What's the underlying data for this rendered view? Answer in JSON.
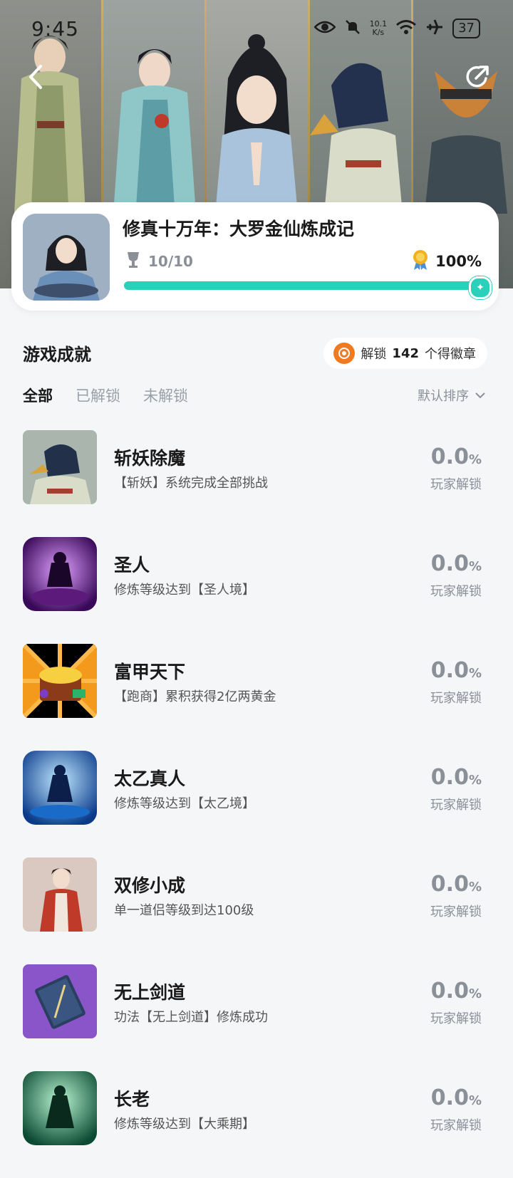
{
  "status_bar": {
    "time": "9:45",
    "net_speed_value": "10.1",
    "net_speed_unit": "K/s",
    "battery": "37"
  },
  "game": {
    "title": "修真十万年：大罗金仙炼成记",
    "trophy_count": "10/10",
    "completion": "100%",
    "progress": 1.0
  },
  "section": {
    "title": "游戏成就",
    "badge_prefix": "解锁",
    "badge_count": "142",
    "badge_suffix": "个得徽章"
  },
  "tabs": [
    "全部",
    "已解锁",
    "未解锁"
  ],
  "sort_label": "默认排序",
  "achievements": [
    {
      "title": "斩妖除魔",
      "desc": "【斩妖】系统完成全部挑战",
      "pct": "0.0",
      "unit": "%",
      "label": "玩家解锁"
    },
    {
      "title": "圣人",
      "desc": "修炼等级达到【圣人境】",
      "pct": "0.0",
      "unit": "%",
      "label": "玩家解锁"
    },
    {
      "title": "富甲天下",
      "desc": "【跑商】累积获得2亿两黄金",
      "pct": "0.0",
      "unit": "%",
      "label": "玩家解锁"
    },
    {
      "title": "太乙真人",
      "desc": "修炼等级达到【太乙境】",
      "pct": "0.0",
      "unit": "%",
      "label": "玩家解锁"
    },
    {
      "title": "双修小成",
      "desc": "单一道侣等级到达100级",
      "pct": "0.0",
      "unit": "%",
      "label": "玩家解锁"
    },
    {
      "title": "无上剑道",
      "desc": "功法【无上剑道】修炼成功",
      "pct": "0.0",
      "unit": "%",
      "label": "玩家解锁"
    },
    {
      "title": "长老",
      "desc": "修炼等级达到【大乘期】",
      "pct": "0.0",
      "unit": "%",
      "label": "玩家解锁"
    }
  ],
  "colors": {
    "accent": "#2ad0b9",
    "badge": "#f07a22",
    "muted": "#8a8f98",
    "background": "#f5f6f8"
  }
}
